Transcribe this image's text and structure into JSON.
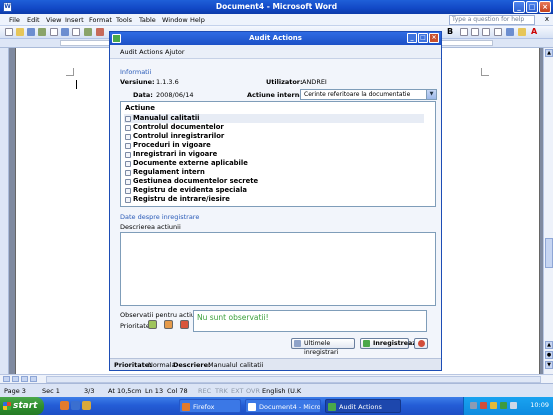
{
  "word": {
    "title": "Document4 - Microsoft Word",
    "menu": [
      "File",
      "Edit",
      "View",
      "Insert",
      "Format",
      "Tools",
      "Table",
      "Window",
      "Help"
    ],
    "help_placeholder": "Type a question for help",
    "close_doc": "x",
    "status": {
      "page": "Page 3",
      "sec": "Sec 1",
      "pages": "3/3",
      "at": "At 10,5cm",
      "ln": "Ln 13",
      "col": "Col 78",
      "rec": "REC",
      "trk": "TRK",
      "ext": "EXT",
      "ovr": "OVR",
      "lang": "English (U.K"
    }
  },
  "taskbar": {
    "start_label": "start",
    "tasks": [
      "Firefox",
      "Document4 - Microsof...",
      "Audit Actions"
    ],
    "clock": "10:09"
  },
  "dialog": {
    "title": "Audit Actions",
    "menu": [
      "Audit Actions",
      "Ajutor"
    ],
    "info_group": "Informatii",
    "versiune_label": "Versiune:",
    "versiune_value": "1.1.3.6",
    "utilizator_label": "Utilizator:",
    "utilizator_value": "ANDREI",
    "data_label": "Data:",
    "data_value": "2008/06/14",
    "actiune_label": "Actiune interna:",
    "actiune_value": "Cerinte referitoare la documentatie",
    "list_header": "Actiune",
    "items": [
      "Manualul calitatii",
      "Controlul documentelor",
      "Controlul inregistrarilor",
      "Proceduri in vigoare",
      "Inregistrari in vigoare",
      "Documente externe aplicabile",
      "Regulament intern",
      "Gestiunea documentelor secrete",
      "Registru de evidenta speciala",
      "Registru de intrare/iesire"
    ],
    "selected_index": 0,
    "data_group": "Date despre inregistrare",
    "descriere_label": "Descrierea actiunii",
    "obs_label": "Observatii pentru actiune:",
    "obs_value": "Nu sunt observatii!",
    "prioritate_label": "Prioritate:",
    "btn_ultimele": "Ultimele inregistrari",
    "btn_inregistreaza": "Inregistreaza",
    "status_prio_label": "Prioritate:",
    "status_prio_value": "Normala",
    "status_desc_label": "Descriere:",
    "status_desc_value": "Manualul calitatii"
  },
  "colors": {
    "title_blue": "#1c50c6",
    "group_label": "#2a5bb8",
    "observation_green": "#3aa03a",
    "prio_low": "#9ec35b",
    "prio_normal": "#e59a4a",
    "prio_high": "#d9553a"
  },
  "icons": [
    "word-doc-icon",
    "minimize-icon",
    "maximize-icon",
    "close-icon",
    "dropdown-arrow-icon",
    "checkbox-icon",
    "history-icon",
    "check-icon",
    "cancel-icon",
    "windows-flag-icon"
  ]
}
